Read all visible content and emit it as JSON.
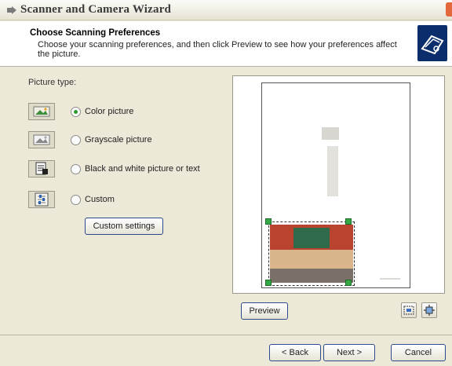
{
  "window": {
    "title": "Scanner and Camera Wizard",
    "close_label": "x"
  },
  "header": {
    "title": "Choose Scanning Preferences",
    "description": "Choose your scanning preferences, and then click Preview to see how your preferences affect the picture."
  },
  "picture_type": {
    "label": "Picture type:",
    "options": [
      {
        "label": "Color picture",
        "selected": true,
        "icon": "color-picture-icon"
      },
      {
        "label": "Grayscale picture",
        "selected": false,
        "icon": "grayscale-picture-icon"
      },
      {
        "label": "Black and white picture or text",
        "selected": false,
        "icon": "black-white-text-icon"
      },
      {
        "label": "Custom",
        "selected": false,
        "icon": "custom-settings-icon"
      }
    ],
    "custom_settings_label": "Custom settings"
  },
  "preview": {
    "button_label": "Preview",
    "tools": [
      "fit-selection-icon",
      "enlarge-selection-icon"
    ]
  },
  "footer": {
    "back_label": "< Back",
    "next_label": "Next >",
    "cancel_label": "Cancel"
  },
  "colors": {
    "dialog_bg": "#ece9d8",
    "button_border": "#2a4b8e",
    "handle_green": "#34a845",
    "header_icon_bg": "#0c2d6b"
  }
}
